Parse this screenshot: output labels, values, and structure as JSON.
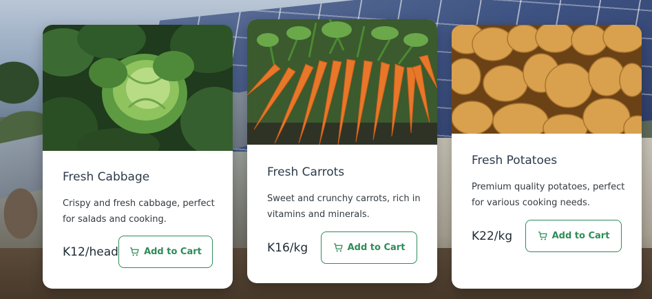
{
  "products": [
    {
      "name": "Fresh Cabbage",
      "description": "Crispy and fresh cabbage, perfect for salads and cooking.",
      "price": "K12/head",
      "button_label": "Add to Cart",
      "image": "cabbage-photo"
    },
    {
      "name": "Fresh Carrots",
      "description": "Sweet and crunchy carrots, rich in vitamins and minerals.",
      "price": "K16/kg",
      "button_label": "Add to Cart",
      "image": "carrots-photo"
    },
    {
      "name": "Fresh Potatoes",
      "description": "Premium quality potatoes, perfect for various cooking needs.",
      "price": "K22/kg",
      "button_label": "Add to Cart",
      "image": "potatoes-photo"
    }
  ],
  "colors": {
    "accent": "#2e8b57",
    "title": "#2b3a4a",
    "card_bg": "#ffffff"
  },
  "icons": {
    "cart": "shopping-cart-icon"
  }
}
